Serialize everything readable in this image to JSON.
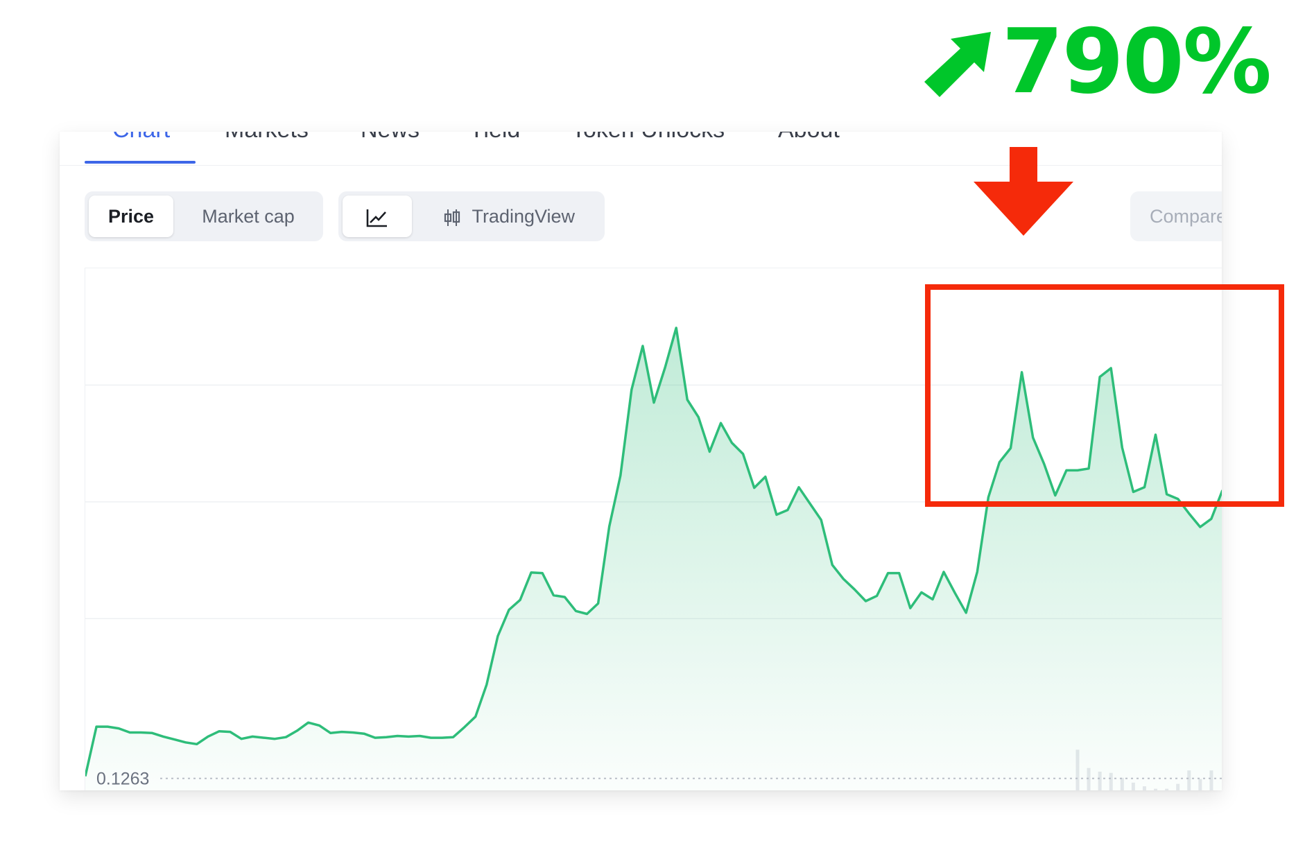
{
  "headline": {
    "value": "790%",
    "color": "#00c62a",
    "icon": "arrow-up-right-icon"
  },
  "tabs": [
    {
      "label": "Chart",
      "active": true
    },
    {
      "label": "Markets",
      "active": false
    },
    {
      "label": "News",
      "active": false
    },
    {
      "label": "Yield",
      "active": false
    },
    {
      "label": "Token Unlocks",
      "active": false
    },
    {
      "label": "About",
      "active": false
    }
  ],
  "metric_toggle": {
    "options": [
      "Price",
      "Market cap"
    ],
    "selected": "Price"
  },
  "chart_style_toggle": {
    "line_icon": "line-chart-icon",
    "candle_icon": "candlestick-icon",
    "candle_label": "TradingView",
    "selected": "line"
  },
  "compare_label": "Compare",
  "colors": {
    "line": "#2ebd7a",
    "accent": "#3d66e8",
    "highlight": "#f52a0a"
  },
  "chart_data": {
    "type": "area",
    "baseline_value": 0.1263,
    "baseline_label": "0.1263",
    "grid": "horizontal",
    "ylim": [
      0.05,
      1.0
    ],
    "values": [
      0.13,
      0.215,
      0.215,
      0.212,
      0.205,
      0.205,
      0.204,
      0.198,
      0.193,
      0.188,
      0.185,
      0.198,
      0.207,
      0.206,
      0.194,
      0.198,
      0.196,
      0.194,
      0.197,
      0.208,
      0.222,
      0.217,
      0.204,
      0.206,
      0.205,
      0.203,
      0.196,
      0.197,
      0.199,
      0.198,
      0.199,
      0.196,
      0.196,
      0.197,
      0.214,
      0.232,
      0.287,
      0.37,
      0.415,
      0.432,
      0.479,
      0.478,
      0.44,
      0.437,
      0.413,
      0.408,
      0.426,
      0.558,
      0.645,
      0.792,
      0.867,
      0.77,
      0.83,
      0.898,
      0.775,
      0.745,
      0.686,
      0.735,
      0.701,
      0.682,
      0.624,
      0.643,
      0.578,
      0.586,
      0.625,
      0.597,
      0.569,
      0.492,
      0.468,
      0.45,
      0.43,
      0.439,
      0.478,
      0.478,
      0.418,
      0.445,
      0.433,
      0.48,
      0.444,
      0.41,
      0.48,
      0.608,
      0.668,
      0.692,
      0.822,
      0.71,
      0.665,
      0.611,
      0.654,
      0.654,
      0.657,
      0.814,
      0.829,
      0.693,
      0.617,
      0.625,
      0.715,
      0.613,
      0.605,
      0.58,
      0.557,
      0.571,
      0.62
    ],
    "volume": [
      0,
      0,
      0,
      0,
      0,
      0,
      0,
      0,
      0,
      0,
      0,
      0,
      0,
      0,
      0,
      0,
      0,
      0,
      0,
      0,
      0,
      0,
      0,
      0,
      0,
      0,
      0,
      0,
      0,
      0,
      0,
      0,
      0,
      0,
      0,
      0,
      0,
      0,
      0,
      0,
      0,
      0,
      0,
      0,
      0,
      0,
      0,
      0,
      0,
      0,
      0,
      0,
      0,
      0,
      0,
      0,
      0.12,
      0,
      0,
      0,
      0,
      0,
      0,
      0,
      0,
      0,
      0,
      0,
      0,
      0,
      0,
      0,
      0,
      0,
      0,
      0,
      0,
      0,
      0,
      0,
      0,
      0,
      0.18,
      0.18,
      0.16,
      0.16,
      0.12,
      0.14,
      0.14,
      0.86,
      0.56,
      0.5,
      0.48,
      0.4,
      0.32,
      0.26,
      0.22,
      0.22,
      0.3,
      0.52,
      0.38,
      0.52,
      0.16
    ]
  }
}
